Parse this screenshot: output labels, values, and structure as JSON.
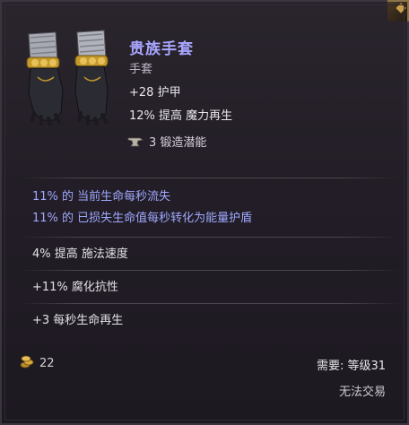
{
  "item": {
    "name": "贵族手套",
    "type": "手套",
    "implicits": [
      "+28 护甲",
      "12% 提高 魔力再生"
    ],
    "forging_potential": "3 锻造潜能"
  },
  "affixes": {
    "set_lines": [
      "11% 的 当前生命每秒流失",
      "11% 的 已损失生命值每秒转化为能量护盾"
    ],
    "lines": [
      "4% 提高 施法速度",
      "+11% 腐化抗性",
      "+3 每秒生命再生"
    ]
  },
  "footer": {
    "gold_value": "22",
    "requirement": "需要: 等级31",
    "tradeable": "无法交易"
  },
  "colors": {
    "name": "#a9a6ff",
    "set_affix": "#9fa8ff",
    "frame_accent": "#c9a04a"
  },
  "icons": [
    "gloves-icon",
    "anvil-icon",
    "gold-coins-icon"
  ]
}
